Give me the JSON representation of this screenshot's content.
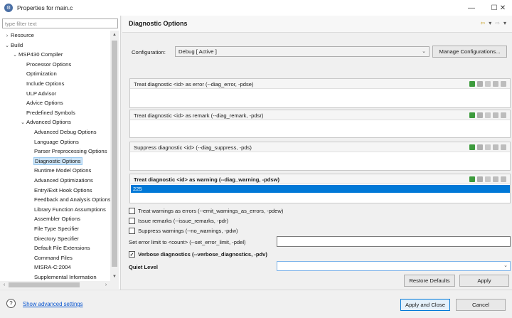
{
  "window": {
    "title": "Properties for main.c",
    "minimize": "—",
    "maximize": "☐",
    "close": "✕"
  },
  "filter": {
    "placeholder": "type filter text"
  },
  "tree": [
    {
      "label": "Resource",
      "twisty": "›",
      "indent": 0
    },
    {
      "label": "Build",
      "twisty": "⌄",
      "indent": 0
    },
    {
      "label": "MSP430 Compiler",
      "twisty": "⌄",
      "indent": 1
    },
    {
      "label": "Processor Options",
      "twisty": "",
      "indent": 2
    },
    {
      "label": "Optimization",
      "twisty": "",
      "indent": 2
    },
    {
      "label": "Include Options",
      "twisty": "",
      "indent": 2
    },
    {
      "label": "ULP Advisor",
      "twisty": "",
      "indent": 2
    },
    {
      "label": "Advice Options",
      "twisty": "",
      "indent": 2
    },
    {
      "label": "Predefined Symbols",
      "twisty": "",
      "indent": 2
    },
    {
      "label": "Advanced Options",
      "twisty": "⌄",
      "indent": 2
    },
    {
      "label": "Advanced Debug Options",
      "twisty": "",
      "indent": 3
    },
    {
      "label": "Language Options",
      "twisty": "",
      "indent": 3
    },
    {
      "label": "Parser Preprocessing Options",
      "twisty": "",
      "indent": 3
    },
    {
      "label": "Diagnostic Options",
      "twisty": "",
      "indent": 3,
      "selected": true
    },
    {
      "label": "Runtime Model Options",
      "twisty": "",
      "indent": 3
    },
    {
      "label": "Advanced Optimizations",
      "twisty": "",
      "indent": 3
    },
    {
      "label": "Entry/Exit Hook Options",
      "twisty": "",
      "indent": 3
    },
    {
      "label": "Feedback and Analysis Options",
      "twisty": "",
      "indent": 3
    },
    {
      "label": "Library Function Assumptions",
      "twisty": "",
      "indent": 3
    },
    {
      "label": "Assembler Options",
      "twisty": "",
      "indent": 3
    },
    {
      "label": "File Type Specifier",
      "twisty": "",
      "indent": 3
    },
    {
      "label": "Directory Specifier",
      "twisty": "",
      "indent": 3
    },
    {
      "label": "Default File Extensions",
      "twisty": "",
      "indent": 3
    },
    {
      "label": "Command Files",
      "twisty": "",
      "indent": 3
    },
    {
      "label": "MISRA-C:2004",
      "twisty": "",
      "indent": 3
    },
    {
      "label": "Supplemental Information",
      "twisty": "",
      "indent": 3
    }
  ],
  "header": {
    "title": "Diagnostic Options",
    "nav_back": "⇦",
    "nav_down": "▾",
    "nav_forward": "⇨",
    "nav_menu": "▾"
  },
  "configuration": {
    "label": "Configuration:",
    "value": "Debug  [ Active ]",
    "manage_button": "Manage Configurations..."
  },
  "lists": {
    "error": {
      "title": "Treat diagnostic <id> as error (--diag_error, -pdse)"
    },
    "remark": {
      "title": "Treat diagnostic <id> as remark (--diag_remark, -pdsr)"
    },
    "suppress": {
      "title": "Suppress diagnostic <id> (--diag_suppress, -pds)"
    },
    "warning": {
      "title": "Treat diagnostic <id> as warning (--diag_warning, -pdsw)",
      "selected_value": "225"
    }
  },
  "checkboxes": {
    "warnings_as_errors": {
      "label": "Treat warnings as errors (--emit_warnings_as_errors, -pdew)",
      "checked": ""
    },
    "issue_remarks": {
      "label": "Issue remarks (--issue_remarks, -pdr)",
      "checked": ""
    },
    "suppress_warnings": {
      "label": "Suppress warnings (--no_warnings, -pdw)",
      "checked": ""
    },
    "verbose": {
      "label": "Verbose diagnostics (--verbose_diagnostics, -pdv)",
      "checked": "✓"
    }
  },
  "error_limit": {
    "label": "Set error limit to <count> (--set_error_limit, -pdel)",
    "value": ""
  },
  "quiet_level": {
    "label": "Quiet Level",
    "value": ""
  },
  "buttons": {
    "restore_defaults": "Restore Defaults",
    "apply": "Apply",
    "apply_close": "Apply and Close",
    "cancel": "Cancel"
  },
  "footer": {
    "help": "?",
    "advanced_link": "Show advanced settings"
  },
  "scroll": {
    "up": "▲",
    "down": "▼",
    "left": "‹",
    "right": "›"
  }
}
